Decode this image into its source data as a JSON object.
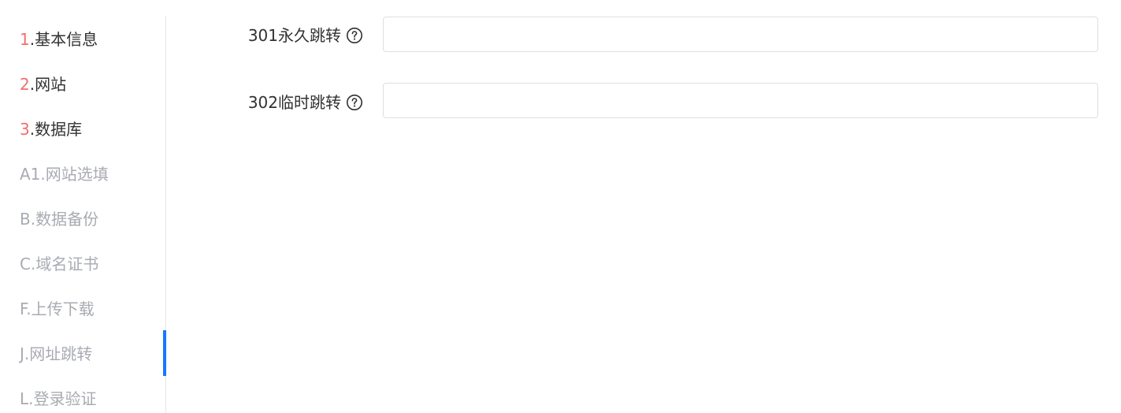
{
  "sidebar": {
    "items": [
      {
        "num": "1",
        "label": ".基本信息"
      },
      {
        "num": "2",
        "label": ".网站"
      },
      {
        "num": "3",
        "label": ".数据库"
      },
      {
        "text": "A1.网站选填"
      },
      {
        "text": "B.数据备份"
      },
      {
        "text": "C.域名证书"
      },
      {
        "text": "F.上传下载"
      },
      {
        "text": "J.网址跳转"
      },
      {
        "text": "L.登录验证"
      }
    ],
    "active_index": 7
  },
  "form": {
    "redirect_301": {
      "label": "301永久跳转",
      "value": ""
    },
    "redirect_302": {
      "label": "302临时跳转",
      "value": ""
    }
  },
  "colors": {
    "number_accent": "#f56c6c",
    "active_indicator": "#1677ff",
    "muted_text": "#a8abb2"
  }
}
